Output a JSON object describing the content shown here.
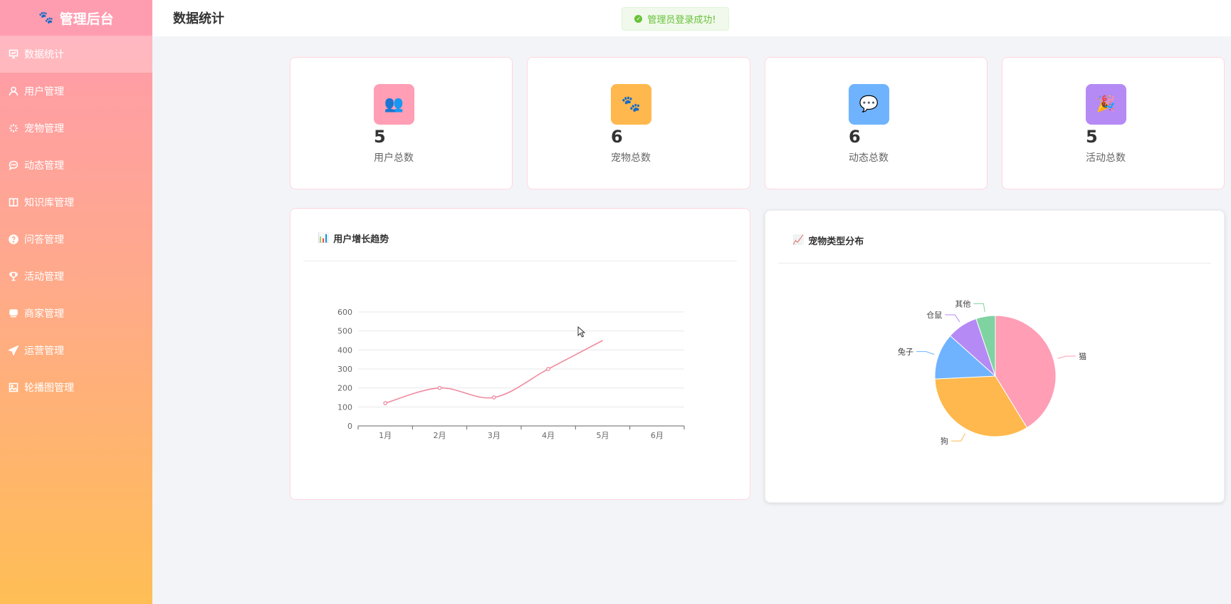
{
  "brand": {
    "title": "管理后台",
    "icon": "paw-icon"
  },
  "sidebar": {
    "items": [
      {
        "label": "数据统计",
        "icon": "chart-icon",
        "active": true
      },
      {
        "label": "用户管理",
        "icon": "user-icon"
      },
      {
        "label": "宠物管理",
        "icon": "loading-icon"
      },
      {
        "label": "动态管理",
        "icon": "chat-bubble-icon"
      },
      {
        "label": "知识库管理",
        "icon": "book-icon"
      },
      {
        "label": "问答管理",
        "icon": "question-icon"
      },
      {
        "label": "活动管理",
        "icon": "trophy-icon"
      },
      {
        "label": "商家管理",
        "icon": "shop-icon"
      },
      {
        "label": "运营管理",
        "icon": "send-icon"
      },
      {
        "label": "轮播图管理",
        "icon": "image-icon"
      }
    ]
  },
  "header": {
    "title": "数据统计"
  },
  "toast": {
    "message": "管理员登录成功!"
  },
  "stats": [
    {
      "value": "5",
      "label": "用户总数",
      "icon": "👥",
      "color": "#ff9eb5"
    },
    {
      "value": "6",
      "label": "宠物总数",
      "icon": "🐾",
      "color": "#ffb84d"
    },
    {
      "value": "6",
      "label": "动态总数",
      "icon": "💬",
      "color": "#6fb3ff"
    },
    {
      "value": "5",
      "label": "活动总数",
      "icon": "🎉",
      "color": "#b58af5"
    }
  ],
  "charts": {
    "growth": {
      "title": "用户增长趋势",
      "icon": "📊"
    },
    "pets": {
      "title": "宠物类型分布",
      "icon": "📈"
    }
  },
  "chart_data": [
    {
      "type": "line",
      "categories": [
        "1月",
        "2月",
        "3月",
        "4月",
        "5月",
        "6月"
      ],
      "series": [
        {
          "values": [
            120,
            200,
            150,
            300,
            450,
            null
          ],
          "color": "#f08aa0"
        }
      ],
      "yticks": [
        0,
        100,
        200,
        300,
        400,
        500,
        600
      ],
      "ylim": [
        0,
        600
      ],
      "grid": true
    },
    {
      "type": "pie",
      "slices": [
        {
          "label": "猫",
          "value": 40,
          "color": "#ff9eb5"
        },
        {
          "label": "狗",
          "value": 32,
          "color": "#ffb84d"
        },
        {
          "label": "兔子",
          "value": 12,
          "color": "#6fb3ff"
        },
        {
          "label": "仓鼠",
          "value": 8,
          "color": "#b58af5"
        },
        {
          "label": "其他",
          "value": 5,
          "color": "#7fd3a0"
        }
      ]
    }
  ]
}
